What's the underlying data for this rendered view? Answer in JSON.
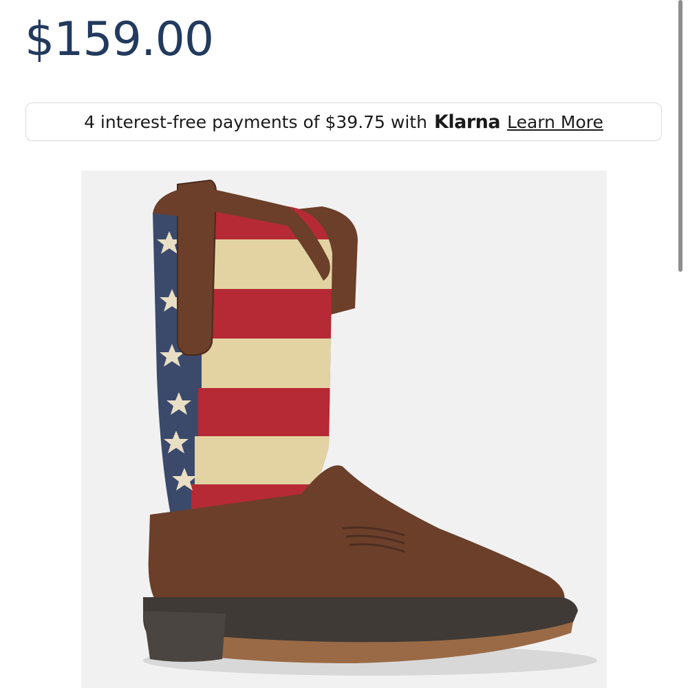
{
  "product": {
    "price": "$159.00"
  },
  "klarna": {
    "text_before": "4 interest-free payments of $39.75 with",
    "brand": "Klarna",
    "learn_more": "Learn More"
  },
  "image": {
    "alt": "Brown western boot with American flag shaft"
  },
  "colors": {
    "price": "#223a5e",
    "leather": "#6b3f2a",
    "flag_red": "#b52a35",
    "flag_cream": "#e3d3a3",
    "flag_blue": "#3b4a6b"
  }
}
